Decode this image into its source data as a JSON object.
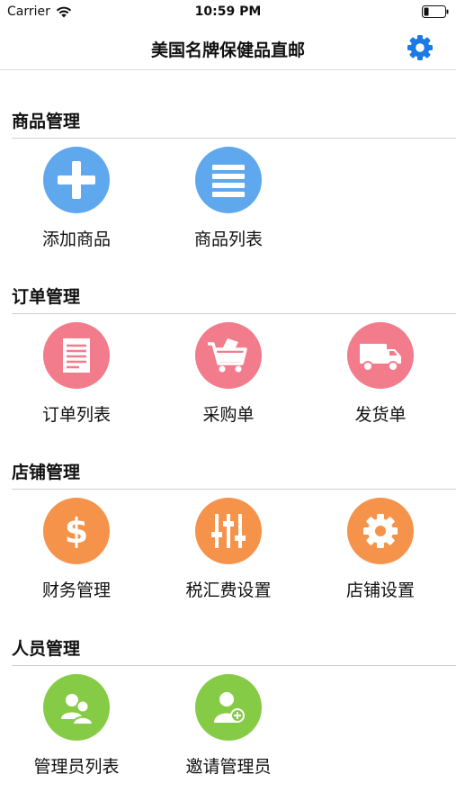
{
  "status_bar": {
    "carrier": "Carrier",
    "time": "10:59 PM"
  },
  "nav": {
    "title": "美国名牌保健品直邮",
    "settings_icon": "gear-icon",
    "accent": "#1a7ae6"
  },
  "sections": [
    {
      "title": "商品管理",
      "color": "#5fa8ee",
      "items": [
        {
          "label": "添加商品",
          "icon": "plus-icon"
        },
        {
          "label": "商品列表",
          "icon": "list-icon"
        }
      ]
    },
    {
      "title": "订单管理",
      "color": "#f27c8c",
      "items": [
        {
          "label": "订单列表",
          "icon": "document-icon"
        },
        {
          "label": "采购单",
          "icon": "shopping-cart-icon"
        },
        {
          "label": "发货单",
          "icon": "truck-icon"
        }
      ]
    },
    {
      "title": "店铺管理",
      "color": "#f6934b",
      "items": [
        {
          "label": "财务管理",
          "icon": "dollar-icon"
        },
        {
          "label": "税汇费设置",
          "icon": "sliders-icon"
        },
        {
          "label": "店铺设置",
          "icon": "gear-icon"
        }
      ]
    },
    {
      "title": "人员管理",
      "color": "#86cb45",
      "items": [
        {
          "label": "管理员列表",
          "icon": "users-icon"
        },
        {
          "label": "邀请管理员",
          "icon": "add-user-icon"
        }
      ]
    }
  ]
}
